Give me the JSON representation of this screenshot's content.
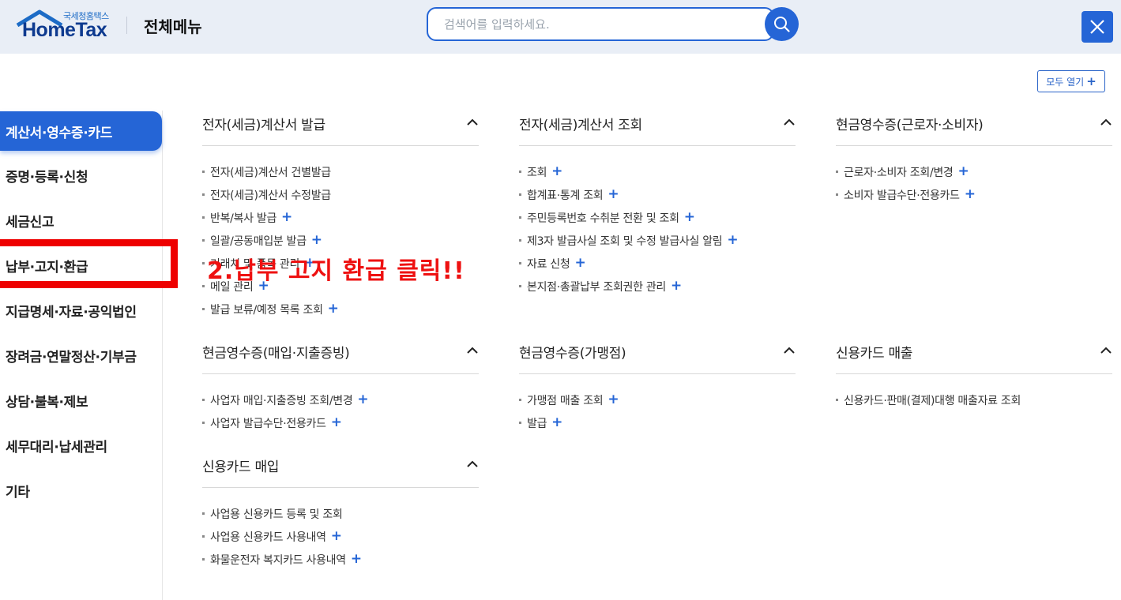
{
  "header": {
    "logo_sub": "국세청홈택스",
    "logo_main": "HomeTax",
    "title": "전체메뉴",
    "search_placeholder": "검색어를 입력하세요.",
    "search_icon": "search-icon",
    "close_icon": "close-icon"
  },
  "expand_all": {
    "label": "모두 열기",
    "icon": "plus-icon"
  },
  "sidebar": {
    "items": [
      {
        "label": "계산서·영수증·카드",
        "active": true
      },
      {
        "label": "증명·등록·신청"
      },
      {
        "label": "세금신고"
      },
      {
        "label": "납부·고지·환급"
      },
      {
        "label": "지급명세·자료·공익법인"
      },
      {
        "label": "장려금·연말정산·기부금"
      },
      {
        "label": "상담·불복·제보"
      },
      {
        "label": "세무대리·납세관리"
      },
      {
        "label": "기타"
      }
    ]
  },
  "sections": [
    {
      "title": "전자(세금)계산서 발급",
      "items": [
        {
          "label": "전자(세금)계산서 건별발급",
          "plus": false
        },
        {
          "label": "전자(세금)계산서 수정발급",
          "plus": false
        },
        {
          "label": "반복/복사 발급",
          "plus": true
        },
        {
          "label": "일괄/공동매입분 발급",
          "plus": true
        },
        {
          "label": "거래처 및 품목 관리",
          "plus": true
        },
        {
          "label": "메일 관리",
          "plus": true
        },
        {
          "label": "발급 보류/예정 목록 조회",
          "plus": true
        }
      ]
    },
    {
      "title": "전자(세금)계산서 조회",
      "items": [
        {
          "label": "조회",
          "plus": true
        },
        {
          "label": "합계표·통계 조회",
          "plus": true
        },
        {
          "label": "주민등록번호 수취분 전환 및 조회",
          "plus": true
        },
        {
          "label": "제3자 발급사실 조회 및 수정 발급사실 알림",
          "plus": true
        },
        {
          "label": "자료 신청",
          "plus": true
        },
        {
          "label": "본지점·총괄납부 조회권한 관리",
          "plus": true
        }
      ]
    },
    {
      "title": "현금영수증(근로자·소비자)",
      "items": [
        {
          "label": "근로자·소비자 조회/변경",
          "plus": true
        },
        {
          "label": "소비자 발급수단·전용카드",
          "plus": true
        }
      ]
    },
    {
      "title": "현금영수증(매입·지출증빙)",
      "items": [
        {
          "label": "사업자 매입·지출증빙 조회/변경",
          "plus": true
        },
        {
          "label": "사업자 발급수단·전용카드",
          "plus": true
        }
      ]
    },
    {
      "title": "현금영수증(가맹점)",
      "items": [
        {
          "label": "가맹점 매출 조회",
          "plus": true
        },
        {
          "label": "발급",
          "plus": true
        }
      ]
    },
    {
      "title": "신용카드 매출",
      "items": [
        {
          "label": "신용카드·판매(결제)대행 매출자료 조회",
          "plus": false
        }
      ]
    },
    {
      "title": "신용카드 매입",
      "items": [
        {
          "label": "사업용 신용카드 등록 및 조회",
          "plus": false
        },
        {
          "label": "사업용 신용카드 사용내역",
          "plus": true
        },
        {
          "label": "화물운전자 복지카드 사용내역",
          "plus": true
        }
      ]
    }
  ],
  "annotation": {
    "text": "2.납부 고지 환급 클릭!!",
    "color": "#ee1111"
  },
  "colors": {
    "accent": "#2565d6",
    "header_bg": "#e9eef6"
  }
}
